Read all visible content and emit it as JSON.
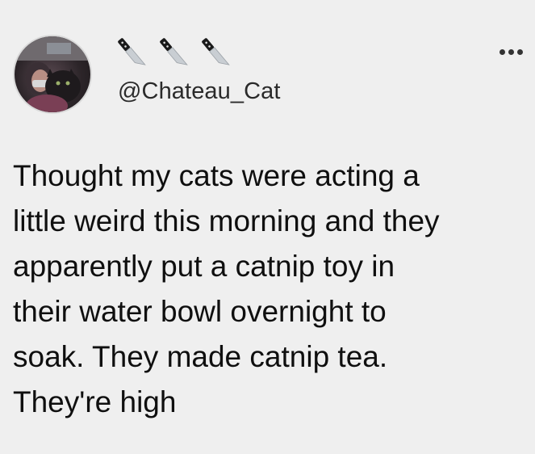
{
  "tweet": {
    "avatar_icon": "profile-photo",
    "display_name_icons": [
      "knife-icon",
      "knife-icon",
      "knife-icon"
    ],
    "handle": "@Chateau_Cat",
    "more_icon": "more-horizontal-icon",
    "text_lines": [
      "Thought my cats were acting a",
      "little weird this morning and they",
      "apparently put a catnip toy in",
      "their water bowl overnight to",
      "soak. They made catnip tea.",
      "They're high"
    ]
  },
  "colors": {
    "background": "#efefef",
    "text": "#0f0f0f",
    "handle": "#2a2a2a"
  }
}
